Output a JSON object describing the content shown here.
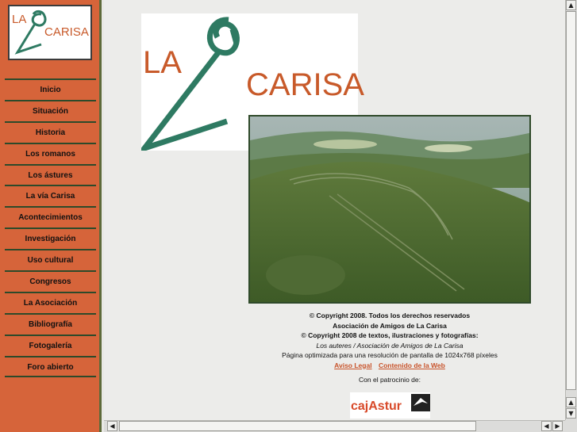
{
  "logo": {
    "line1": "LA",
    "line2": "CARISA"
  },
  "nav": {
    "items": [
      "Inicio",
      "Situación",
      "Historia",
      "Los romanos",
      "Los ástures",
      "La vía Carisa",
      "Acontecimientos",
      "Investigación",
      "Uso cultural",
      "Congresos",
      "La Asociación",
      "Bibliografía",
      "Fotogalería",
      "Foro abierto"
    ]
  },
  "footer": {
    "copyright": "© Copyright 2008. Todos los derechos reservados",
    "association": "Asociación de Amigos de La Carisa",
    "copyright_texts": "© Copyright 2008 de textos, ilustraciones y fotografías:",
    "authors": "Los auteres / Asociación de Amigos de La Carisa",
    "optimized": "Página optimizada para una resolución de pantalla de 1024x768 píxeles",
    "aviso_legal": "Aviso Legal",
    "contenido": "Contenido de la Web",
    "sponsor_label": "Con el patrocinio de:",
    "sponsor_name": "cajAstur"
  },
  "colors": {
    "sidebar": "#d6643a",
    "brand_orange": "#c85a2a",
    "brand_green": "#2e7a62",
    "link": "#c8532a"
  },
  "icons": {
    "scroll_up": "arrow-up-icon",
    "scroll_down": "arrow-down-icon",
    "scroll_left": "arrow-left-icon",
    "scroll_right": "arrow-right-icon"
  }
}
